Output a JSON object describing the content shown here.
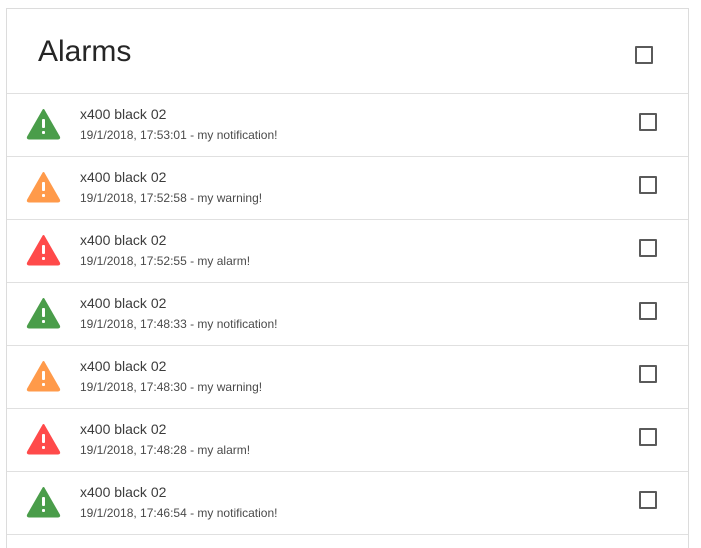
{
  "header": {
    "title": "Alarms",
    "select_all": false
  },
  "colors": {
    "notification": "#4a9d4a",
    "warning": "#ff9a4a",
    "alarm": "#ff4a4a"
  },
  "alarms": [
    {
      "severity": "notification",
      "icon": "warning-triangle-icon",
      "device": "x400 black 02",
      "detail": "19/1/2018, 17:53:01 - my notification!",
      "checked": false
    },
    {
      "severity": "warning",
      "icon": "warning-triangle-icon",
      "device": "x400 black 02",
      "detail": "19/1/2018, 17:52:58 - my warning!",
      "checked": false
    },
    {
      "severity": "alarm",
      "icon": "warning-triangle-icon",
      "device": "x400 black 02",
      "detail": "19/1/2018, 17:52:55 - my alarm!",
      "checked": false
    },
    {
      "severity": "notification",
      "icon": "warning-triangle-icon",
      "device": "x400 black 02",
      "detail": "19/1/2018, 17:48:33 - my notification!",
      "checked": false
    },
    {
      "severity": "warning",
      "icon": "warning-triangle-icon",
      "device": "x400 black 02",
      "detail": "19/1/2018, 17:48:30 - my warning!",
      "checked": false
    },
    {
      "severity": "alarm",
      "icon": "warning-triangle-icon",
      "device": "x400 black 02",
      "detail": "19/1/2018, 17:48:28 - my alarm!",
      "checked": false
    },
    {
      "severity": "notification",
      "icon": "warning-triangle-icon",
      "device": "x400 black 02",
      "detail": "19/1/2018, 17:46:54 - my notification!",
      "checked": false
    }
  ]
}
